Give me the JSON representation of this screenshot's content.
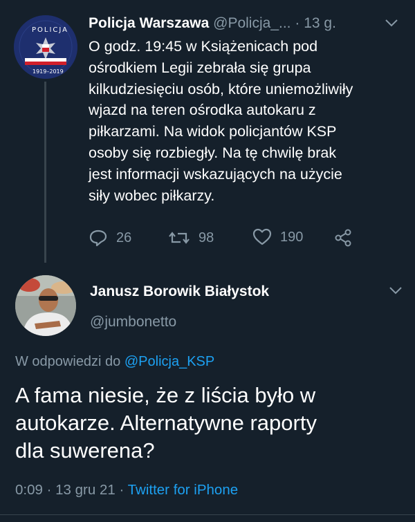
{
  "tweet1": {
    "author_name": "Policja Warszawa",
    "author_handle": "@Policja_...",
    "separator": "·",
    "time": "13 g.",
    "avatar": {
      "icon": "police-badge-logo",
      "text_top": "POLICJA",
      "text_bottom": "1919–2019",
      "colors": {
        "bg": "#1e2f6e",
        "red": "#d21f2b",
        "white": "#ffffff"
      }
    },
    "text": "O godz. 19:45 w Książenicach pod\nośrodkiem Legii zebrała się grupa\nkilkudziesięciu osób, które uniemożliwiły\nwjazd na teren ośrodka autokaru z\npiłkarzami. Na widok policjantów KSP\nosoby się rozbiegły. Na tę chwilę brak\njest  informacji wskazujących na użycie\nsiły wobec piłkarzy.",
    "actions": {
      "replies": "26",
      "retweets": "98",
      "likes": "190"
    }
  },
  "tweet2": {
    "author_name": "Janusz Borowik Białystok",
    "author_handle": "@jumbonetto",
    "reply_prefix": "W odpowiedzi do",
    "reply_to": "@Policja_KSP",
    "text": "A fama niesie, że z liścia było w\nautokarze. Alternatywne raporty\ndla suwerena?",
    "time": "0:09",
    "date": "13 gru 21",
    "source": "Twitter for iPhone",
    "separator": "·"
  },
  "colors": {
    "background": "#15202b",
    "text": "#ffffff",
    "muted": "#8899a6",
    "link": "#1da1f2",
    "divider": "#38444d"
  }
}
